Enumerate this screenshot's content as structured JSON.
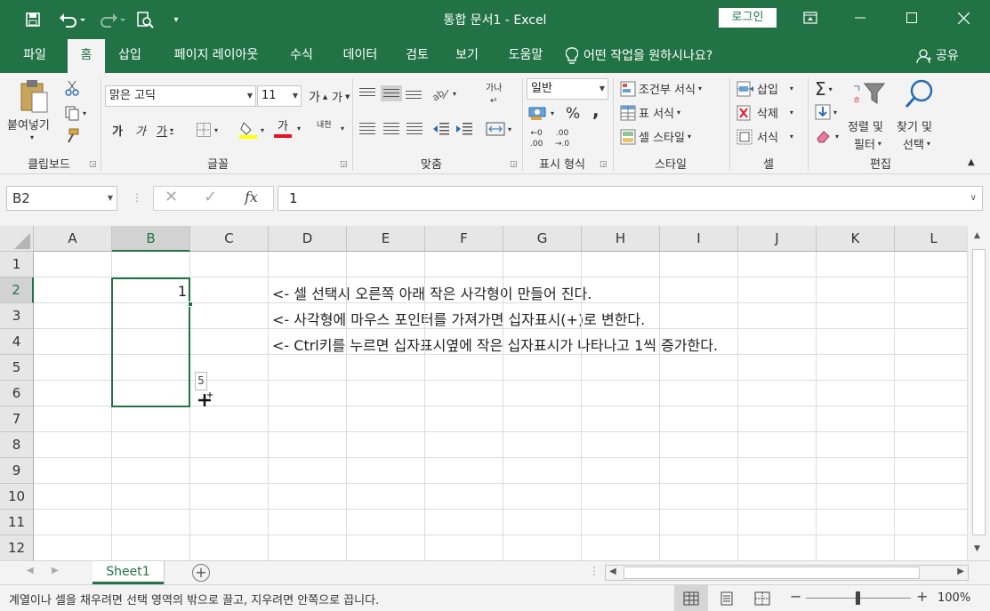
{
  "window": {
    "title": "통합 문서1  -  Excel",
    "login_label": "로그인"
  },
  "qat": {
    "save_icon": "save-icon",
    "undo_icon": "undo-icon",
    "redo_icon": "redo-icon",
    "print_preview_icon": "print-preview-icon",
    "customize_icon": "customize-icon"
  },
  "tabs": [
    "파일",
    "홈",
    "삽입",
    "페이지 레이아웃",
    "수식",
    "데이터",
    "검토",
    "보기",
    "도움말"
  ],
  "tell_me": "어떤 작업을 원하시나요?",
  "share": "공유",
  "ribbon": {
    "clipboard": {
      "label": "클립보드",
      "paste": "붙여넣기"
    },
    "font": {
      "label": "글꼴",
      "name": "맑은 고딕",
      "size": "11",
      "grow": "가",
      "shrink": "가",
      "bold": "가",
      "italic": "가",
      "underline": "가",
      "font_color": "가",
      "phonetic": "내천"
    },
    "alignment": {
      "label": "맞춤",
      "wrap": "가나"
    },
    "number": {
      "label": "표시 형식",
      "format": "일반",
      "percent": "%",
      "comma": ","
    },
    "styles": {
      "label": "스타일",
      "conditional": "조건부 서식",
      "table": "표 서식",
      "cell_styles": "셀 스타일"
    },
    "cells": {
      "label": "셀",
      "insert": "삽입",
      "delete": "삭제",
      "format": "서식"
    },
    "editing": {
      "label": "편집",
      "sort": "정렬 및",
      "sort2": "필터",
      "find": "찾기 및",
      "find2": "선택"
    }
  },
  "formula_bar": {
    "name_box": "B2",
    "value": "1",
    "fx": "fx"
  },
  "columns": [
    "A",
    "B",
    "C",
    "D",
    "E",
    "F",
    "G",
    "H",
    "I",
    "J",
    "K",
    "L"
  ],
  "rows": [
    "1",
    "2",
    "3",
    "4",
    "5",
    "6",
    "7",
    "8",
    "9",
    "10",
    "11",
    "12"
  ],
  "cells": {
    "B2": "1",
    "D2": "<- 셀 선택시 오른쪽 아래 작은 사각형이 만들어 진다.",
    "D3": "<- 사각형에 마우스 포인터를 가져가면 십자표시(+)로 변한다.",
    "D4": "<- Ctrl키를 누르면 십자표시옆에 작은 십자표시가 나타나고 1씩 증가한다."
  },
  "fill_tooltip": "5",
  "sheet": {
    "name": "Sheet1"
  },
  "status": {
    "message": "계열이나 셀을 채우려면 선택 영역의 밖으로 끌고, 지우려면 안쪽으로 끕니다.",
    "zoom": "100%"
  },
  "colors": {
    "accent": "#217346"
  }
}
